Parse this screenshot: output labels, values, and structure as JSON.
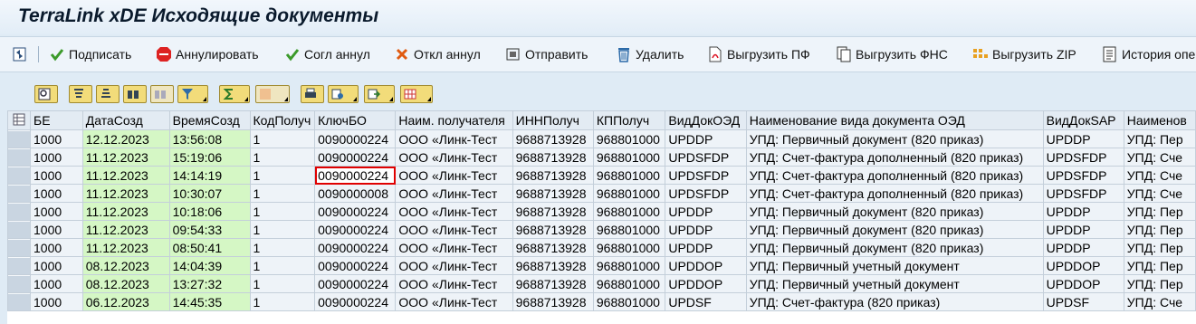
{
  "window": {
    "title": "TerraLink xDE Исходящие документы"
  },
  "toolbar": {
    "sign": "Подписать",
    "cancel": "Аннулировать",
    "agree_cancel": "Согл аннул",
    "reject_cancel": "Откл аннул",
    "send": "Отправить",
    "delete": "Удалить",
    "export_pf": "Выгрузить ПФ",
    "export_fns": "Выгрузить ФНС",
    "export_zip": "Выгрузить ZIP",
    "history": "История опе"
  },
  "table": {
    "columns": [
      "БЕ",
      "ДатаСозд",
      "ВремяСозд",
      "КодПолуч",
      "КлючБО",
      "Наим. получателя",
      "ИННПолуч",
      "КППолуч",
      "ВидДокОЭД",
      "Наименование вида документа ОЭД",
      "ВидДокSAP",
      "Наименов"
    ],
    "rows": [
      [
        "1000",
        "12.12.2023",
        "13:56:08",
        "1",
        "0090000224",
        "ООО «Линк-Тест",
        "9688713928",
        "968801000",
        "UPDDP",
        "УПД: Первичный документ (820 приказ)",
        "UPDDP",
        "УПД: Пер"
      ],
      [
        "1000",
        "11.12.2023",
        "15:19:06",
        "1",
        "0090000224",
        "ООО «Линк-Тест",
        "9688713928",
        "968801000",
        "UPDSFDP",
        "УПД: Счет-фактура дополненный (820 приказ)",
        "UPDSFDP",
        "УПД: Сче"
      ],
      [
        "1000",
        "11.12.2023",
        "14:14:19",
        "1",
        "0090000224",
        "ООО «Линк-Тест",
        "9688713928",
        "968801000",
        "UPDSFDP",
        "УПД: Счет-фактура дополненный (820 приказ)",
        "UPDSFDP",
        "УПД: Сче"
      ],
      [
        "1000",
        "11.12.2023",
        "10:30:07",
        "1",
        "0090000008",
        "ООО «Линк-Тест",
        "9688713928",
        "968801000",
        "UPDSFDP",
        "УПД: Счет-фактура дополненный (820 приказ)",
        "UPDSFDP",
        "УПД: Сче"
      ],
      [
        "1000",
        "11.12.2023",
        "10:18:06",
        "1",
        "0090000224",
        "ООО «Линк-Тест",
        "9688713928",
        "968801000",
        "UPDDP",
        "УПД: Первичный документ (820 приказ)",
        "UPDDP",
        "УПД: Пер"
      ],
      [
        "1000",
        "11.12.2023",
        "09:54:33",
        "1",
        "0090000224",
        "ООО «Линк-Тест",
        "9688713928",
        "968801000",
        "UPDDP",
        "УПД: Первичный документ (820 приказ)",
        "UPDDP",
        "УПД: Пер"
      ],
      [
        "1000",
        "11.12.2023",
        "08:50:41",
        "1",
        "0090000224",
        "ООО «Линк-Тест",
        "9688713928",
        "968801000",
        "UPDDP",
        "УПД: Первичный документ (820 приказ)",
        "UPDDP",
        "УПД: Пер"
      ],
      [
        "1000",
        "08.12.2023",
        "14:04:39",
        "1",
        "0090000224",
        "ООО «Линк-Тест",
        "9688713928",
        "968801000",
        "UPDDOP",
        "УПД: Первичный учетный документ",
        "UPDDOP",
        "УПД: Пер"
      ],
      [
        "1000",
        "08.12.2023",
        "13:27:32",
        "1",
        "0090000224",
        "ООО «Линк-Тест",
        "9688713928",
        "968801000",
        "UPDDOP",
        "УПД: Первичный учетный документ",
        "UPDDOP",
        "УПД: Пер"
      ],
      [
        "1000",
        "06.12.2023",
        "14:45:35",
        "1",
        "0090000224",
        "ООО «Линк-Тест",
        "9688713928",
        "968801000",
        "UPDSF",
        "УПД: Счет-фактура (820 приказ)",
        "UPDSF",
        "УПД: Сче"
      ]
    ],
    "highlighted_row": 2,
    "highlighted_col": 4
  },
  "colors": {
    "date_time_bg": "#d5f7c5",
    "highlight_border": "#e00000",
    "alv_button": "#f2dc7a"
  }
}
